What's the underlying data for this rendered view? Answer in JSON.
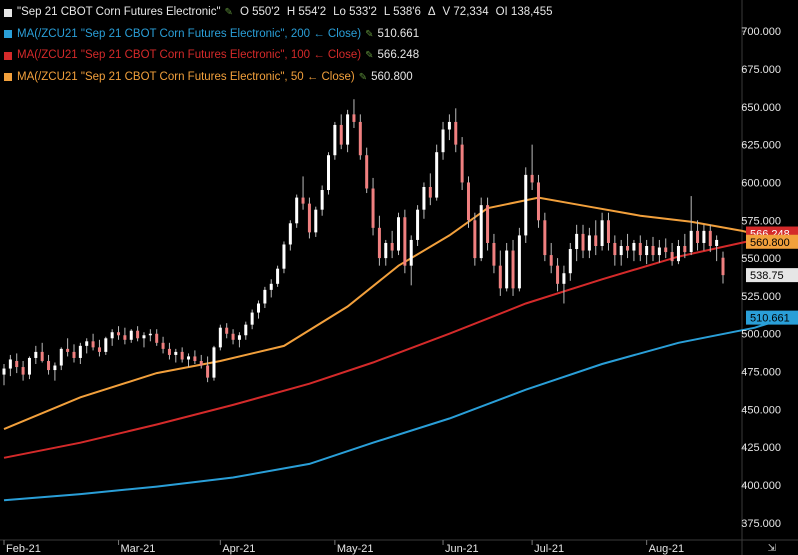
{
  "legend": {
    "main": {
      "label": "\"Sep 21 CBOT Corn Futures Electronic\"",
      "open": "O 550'2",
      "high": "H 554'2",
      "low": "Lo 533'2",
      "last": "L 538'6",
      "delta": "Δ",
      "volume": "V 72,334",
      "oi": "OI 138,455",
      "color": "#e6e6e6"
    },
    "ma200": {
      "label": "MA(/ZCU21 \"Sep 21 CBOT Corn Futures Electronic\", 200 ← Close)",
      "value": "510.661",
      "color": "#2a9fd8"
    },
    "ma100": {
      "label": "MA(/ZCU21 \"Sep 21 CBOT Corn Futures Electronic\", 100 ← Close)",
      "value": "566.248",
      "color": "#d42a2a"
    },
    "ma50": {
      "label": "MA(/ZCU21 \"Sep 21 CBOT Corn Futures Electronic\", 50 ← Close)",
      "value": "560.800",
      "color": "#f2a03c"
    }
  },
  "icons": {
    "edit": "pencil-icon",
    "expand": "expand-icon"
  },
  "chart_data": {
    "type": "candlestick",
    "title": "Sep 21 CBOT Corn Futures Electronic",
    "ylim": [
      365,
      712
    ],
    "yticks": [
      "375.000",
      "400.000",
      "425.000",
      "450.000",
      "475.000",
      "500.000",
      "525.000",
      "550.000",
      "575.000",
      "600.000",
      "625.000",
      "650.000",
      "675.000",
      "700.000"
    ],
    "xticks": [
      "Feb-21",
      "Mar-21",
      "Apr-21",
      "May-21",
      "Jun-21",
      "Jul-21",
      "Aug-21"
    ],
    "colors": {
      "up": "#ffffff",
      "down": "#f08080",
      "wick": "#bbbbbb"
    },
    "candles": [
      {
        "x": "Feb-21",
        "o": 473,
        "h": 480,
        "l": 466,
        "c": 477
      },
      {
        "x": "",
        "o": 477,
        "h": 486,
        "l": 472,
        "c": 483
      },
      {
        "x": "",
        "o": 482,
        "h": 487,
        "l": 474,
        "c": 478
      },
      {
        "x": "",
        "o": 478,
        "h": 482,
        "l": 469,
        "c": 473
      },
      {
        "x": "",
        "o": 473,
        "h": 485,
        "l": 470,
        "c": 484
      },
      {
        "x": "",
        "o": 484,
        "h": 492,
        "l": 480,
        "c": 488
      },
      {
        "x": "",
        "o": 488,
        "h": 494,
        "l": 481,
        "c": 482
      },
      {
        "x": "",
        "o": 482,
        "h": 486,
        "l": 473,
        "c": 476
      },
      {
        "x": "",
        "o": 476,
        "h": 481,
        "l": 469,
        "c": 479
      },
      {
        "x": "",
        "o": 479,
        "h": 491,
        "l": 476,
        "c": 490
      },
      {
        "x": "",
        "o": 490,
        "h": 497,
        "l": 485,
        "c": 488
      },
      {
        "x": "",
        "o": 488,
        "h": 493,
        "l": 481,
        "c": 484
      },
      {
        "x": "",
        "o": 484,
        "h": 494,
        "l": 480,
        "c": 492
      },
      {
        "x": "",
        "o": 492,
        "h": 497,
        "l": 487,
        "c": 495
      },
      {
        "x": "",
        "o": 495,
        "h": 500,
        "l": 489,
        "c": 491
      },
      {
        "x": "",
        "o": 491,
        "h": 496,
        "l": 485,
        "c": 488
      },
      {
        "x": "",
        "o": 488,
        "h": 498,
        "l": 486,
        "c": 497
      },
      {
        "x": "",
        "o": 497,
        "h": 503,
        "l": 492,
        "c": 501
      },
      {
        "x": "Mar-21",
        "o": 501,
        "h": 505,
        "l": 496,
        "c": 499
      },
      {
        "x": "",
        "o": 499,
        "h": 504,
        "l": 493,
        "c": 496
      },
      {
        "x": "",
        "o": 496,
        "h": 503,
        "l": 494,
        "c": 502
      },
      {
        "x": "",
        "o": 502,
        "h": 505,
        "l": 495,
        "c": 497
      },
      {
        "x": "",
        "o": 497,
        "h": 501,
        "l": 491,
        "c": 499
      },
      {
        "x": "",
        "o": 499,
        "h": 503,
        "l": 495,
        "c": 500
      },
      {
        "x": "",
        "o": 500,
        "h": 503,
        "l": 492,
        "c": 494
      },
      {
        "x": "",
        "o": 494,
        "h": 498,
        "l": 487,
        "c": 490
      },
      {
        "x": "",
        "o": 490,
        "h": 494,
        "l": 483,
        "c": 486
      },
      {
        "x": "",
        "o": 486,
        "h": 490,
        "l": 481,
        "c": 488
      },
      {
        "x": "",
        "o": 488,
        "h": 491,
        "l": 481,
        "c": 483
      },
      {
        "x": "",
        "o": 483,
        "h": 487,
        "l": 478,
        "c": 485
      },
      {
        "x": "",
        "o": 485,
        "h": 489,
        "l": 480,
        "c": 482
      },
      {
        "x": "",
        "o": 482,
        "h": 486,
        "l": 477,
        "c": 479
      },
      {
        "x": "",
        "o": 479,
        "h": 485,
        "l": 468,
        "c": 471
      },
      {
        "x": "",
        "o": 471,
        "h": 492,
        "l": 469,
        "c": 491
      },
      {
        "x": "Apr-21",
        "o": 491,
        "h": 506,
        "l": 489,
        "c": 504
      },
      {
        "x": "",
        "o": 504,
        "h": 507,
        "l": 497,
        "c": 500
      },
      {
        "x": "",
        "o": 500,
        "h": 503,
        "l": 493,
        "c": 496
      },
      {
        "x": "",
        "o": 496,
        "h": 501,
        "l": 491,
        "c": 499
      },
      {
        "x": "",
        "o": 499,
        "h": 508,
        "l": 496,
        "c": 506
      },
      {
        "x": "",
        "o": 506,
        "h": 516,
        "l": 503,
        "c": 514
      },
      {
        "x": "",
        "o": 514,
        "h": 522,
        "l": 510,
        "c": 520
      },
      {
        "x": "",
        "o": 520,
        "h": 531,
        "l": 517,
        "c": 529
      },
      {
        "x": "",
        "o": 529,
        "h": 536,
        "l": 524,
        "c": 533
      },
      {
        "x": "",
        "o": 533,
        "h": 545,
        "l": 531,
        "c": 543
      },
      {
        "x": "",
        "o": 543,
        "h": 561,
        "l": 540,
        "c": 559
      },
      {
        "x": "",
        "o": 559,
        "h": 575,
        "l": 555,
        "c": 573
      },
      {
        "x": "",
        "o": 573,
        "h": 592,
        "l": 570,
        "c": 590
      },
      {
        "x": "",
        "o": 590,
        "h": 604,
        "l": 582,
        "c": 586
      },
      {
        "x": "",
        "o": 586,
        "h": 590,
        "l": 563,
        "c": 567
      },
      {
        "x": "",
        "o": 567,
        "h": 584,
        "l": 564,
        "c": 582
      },
      {
        "x": "",
        "o": 582,
        "h": 598,
        "l": 578,
        "c": 595
      },
      {
        "x": "",
        "o": 595,
        "h": 620,
        "l": 592,
        "c": 618
      },
      {
        "x": "May-21",
        "o": 618,
        "h": 640,
        "l": 615,
        "c": 638
      },
      {
        "x": "",
        "o": 638,
        "h": 645,
        "l": 622,
        "c": 625
      },
      {
        "x": "",
        "o": 625,
        "h": 648,
        "l": 620,
        "c": 645
      },
      {
        "x": "",
        "o": 645,
        "h": 655,
        "l": 636,
        "c": 640
      },
      {
        "x": "",
        "o": 640,
        "h": 645,
        "l": 615,
        "c": 618
      },
      {
        "x": "",
        "o": 618,
        "h": 623,
        "l": 593,
        "c": 596
      },
      {
        "x": "",
        "o": 596,
        "h": 603,
        "l": 565,
        "c": 570
      },
      {
        "x": "",
        "o": 570,
        "h": 578,
        "l": 545,
        "c": 550
      },
      {
        "x": "",
        "o": 550,
        "h": 562,
        "l": 545,
        "c": 560
      },
      {
        "x": "",
        "o": 560,
        "h": 568,
        "l": 550,
        "c": 555
      },
      {
        "x": "",
        "o": 555,
        "h": 580,
        "l": 552,
        "c": 577
      },
      {
        "x": "",
        "o": 577,
        "h": 582,
        "l": 540,
        "c": 545
      },
      {
        "x": "",
        "o": 545,
        "h": 565,
        "l": 532,
        "c": 562
      },
      {
        "x": "",
        "o": 562,
        "h": 585,
        "l": 558,
        "c": 582
      },
      {
        "x": "",
        "o": 582,
        "h": 600,
        "l": 576,
        "c": 597
      },
      {
        "x": "",
        "o": 597,
        "h": 606,
        "l": 585,
        "c": 590
      },
      {
        "x": "",
        "o": 590,
        "h": 625,
        "l": 588,
        "c": 620
      },
      {
        "x": "Jun-21",
        "o": 620,
        "h": 640,
        "l": 615,
        "c": 635
      },
      {
        "x": "",
        "o": 635,
        "h": 645,
        "l": 628,
        "c": 640
      },
      {
        "x": "",
        "o": 640,
        "h": 649,
        "l": 620,
        "c": 625
      },
      {
        "x": "",
        "o": 625,
        "h": 630,
        "l": 595,
        "c": 600
      },
      {
        "x": "",
        "o": 600,
        "h": 604,
        "l": 570,
        "c": 575
      },
      {
        "x": "",
        "o": 575,
        "h": 580,
        "l": 545,
        "c": 550
      },
      {
        "x": "",
        "o": 550,
        "h": 590,
        "l": 548,
        "c": 585
      },
      {
        "x": "",
        "o": 585,
        "h": 590,
        "l": 555,
        "c": 560
      },
      {
        "x": "",
        "o": 560,
        "h": 566,
        "l": 540,
        "c": 545
      },
      {
        "x": "",
        "o": 545,
        "h": 555,
        "l": 525,
        "c": 530
      },
      {
        "x": "",
        "o": 530,
        "h": 560,
        "l": 528,
        "c": 555
      },
      {
        "x": "",
        "o": 555,
        "h": 562,
        "l": 525,
        "c": 530
      },
      {
        "x": "",
        "o": 530,
        "h": 570,
        "l": 528,
        "c": 565
      },
      {
        "x": "",
        "o": 565,
        "h": 610,
        "l": 560,
        "c": 605
      },
      {
        "x": "Jul-21",
        "o": 605,
        "h": 625,
        "l": 595,
        "c": 600
      },
      {
        "x": "",
        "o": 600,
        "h": 605,
        "l": 570,
        "c": 575
      },
      {
        "x": "",
        "o": 575,
        "h": 580,
        "l": 548,
        "c": 552
      },
      {
        "x": "",
        "o": 552,
        "h": 560,
        "l": 540,
        "c": 545
      },
      {
        "x": "",
        "o": 545,
        "h": 550,
        "l": 528,
        "c": 533
      },
      {
        "x": "",
        "o": 533,
        "h": 545,
        "l": 520,
        "c": 540
      },
      {
        "x": "",
        "o": 540,
        "h": 560,
        "l": 535,
        "c": 556
      },
      {
        "x": "",
        "o": 556,
        "h": 572,
        "l": 548,
        "c": 566
      },
      {
        "x": "",
        "o": 566,
        "h": 572,
        "l": 550,
        "c": 555
      },
      {
        "x": "",
        "o": 555,
        "h": 570,
        "l": 550,
        "c": 565
      },
      {
        "x": "",
        "o": 565,
        "h": 575,
        "l": 552,
        "c": 558
      },
      {
        "x": "",
        "o": 558,
        "h": 580,
        "l": 555,
        "c": 575
      },
      {
        "x": "",
        "o": 575,
        "h": 580,
        "l": 555,
        "c": 560
      },
      {
        "x": "",
        "o": 560,
        "h": 565,
        "l": 545,
        "c": 552
      },
      {
        "x": "",
        "o": 552,
        "h": 562,
        "l": 545,
        "c": 558
      },
      {
        "x": "",
        "o": 558,
        "h": 566,
        "l": 550,
        "c": 555
      },
      {
        "x": "",
        "o": 555,
        "h": 562,
        "l": 548,
        "c": 560
      },
      {
        "x": "",
        "o": 560,
        "h": 565,
        "l": 548,
        "c": 552
      },
      {
        "x": "Aug-21",
        "o": 552,
        "h": 562,
        "l": 546,
        "c": 558
      },
      {
        "x": "",
        "o": 558,
        "h": 564,
        "l": 548,
        "c": 552
      },
      {
        "x": "",
        "o": 552,
        "h": 562,
        "l": 547,
        "c": 557
      },
      {
        "x": "",
        "o": 557,
        "h": 563,
        "l": 550,
        "c": 554
      },
      {
        "x": "",
        "o": 554,
        "h": 560,
        "l": 545,
        "c": 548
      },
      {
        "x": "",
        "o": 548,
        "h": 562,
        "l": 546,
        "c": 558
      },
      {
        "x": "",
        "o": 558,
        "h": 566,
        "l": 550,
        "c": 554
      },
      {
        "x": "",
        "o": 554,
        "h": 591,
        "l": 552,
        "c": 568
      },
      {
        "x": "",
        "o": 568,
        "h": 575,
        "l": 555,
        "c": 560
      },
      {
        "x": "",
        "o": 560,
        "h": 572,
        "l": 555,
        "c": 568
      },
      {
        "x": "",
        "o": 568,
        "h": 572,
        "l": 554,
        "c": 558
      },
      {
        "x": "",
        "o": 558,
        "h": 565,
        "l": 548,
        "c": 562
      },
      {
        "x": "",
        "o": 550.25,
        "h": 554.25,
        "l": 533.25,
        "c": 538.75
      }
    ],
    "series": [
      {
        "name": "MA 200",
        "color": "#2a9fd8",
        "values": [
          [
            0,
            390
          ],
          [
            12,
            394
          ],
          [
            24,
            399
          ],
          [
            36,
            405
          ],
          [
            48,
            414
          ],
          [
            58,
            428
          ],
          [
            70,
            444
          ],
          [
            82,
            463
          ],
          [
            94,
            480
          ],
          [
            106,
            494
          ],
          [
            118,
            504
          ],
          [
            123,
            510.661
          ]
        ]
      },
      {
        "name": "MA 100",
        "color": "#d42a2a",
        "values": [
          [
            0,
            418
          ],
          [
            12,
            428
          ],
          [
            24,
            440
          ],
          [
            36,
            453
          ],
          [
            48,
            467
          ],
          [
            58,
            481
          ],
          [
            70,
            500
          ],
          [
            82,
            520
          ],
          [
            94,
            536
          ],
          [
            106,
            551
          ],
          [
            118,
            562
          ],
          [
            123,
            566.248
          ]
        ]
      },
      {
        "name": "MA 50",
        "color": "#f2a03c",
        "values": [
          [
            0,
            437
          ],
          [
            12,
            458
          ],
          [
            24,
            474
          ],
          [
            34,
            482
          ],
          [
            44,
            492
          ],
          [
            54,
            518
          ],
          [
            62,
            545
          ],
          [
            70,
            565
          ],
          [
            76,
            583
          ],
          [
            84,
            590
          ],
          [
            92,
            584
          ],
          [
            100,
            578
          ],
          [
            108,
            574
          ],
          [
            116,
            568
          ],
          [
            123,
            560.8
          ]
        ]
      }
    ],
    "axis_badges": [
      {
        "text": "566.248",
        "bg": "#d42a2a",
        "fg": "#ffffff",
        "y": 566.248
      },
      {
        "text": "560.800",
        "bg": "#f2a03c",
        "fg": "#000000",
        "y": 560.8
      },
      {
        "text": "538.75",
        "bg": "#e6e6e6",
        "fg": "#000000",
        "y": 538.75
      },
      {
        "text": "510.661",
        "bg": "#2a9fd8",
        "fg": "#000000",
        "y": 510.661
      }
    ]
  }
}
